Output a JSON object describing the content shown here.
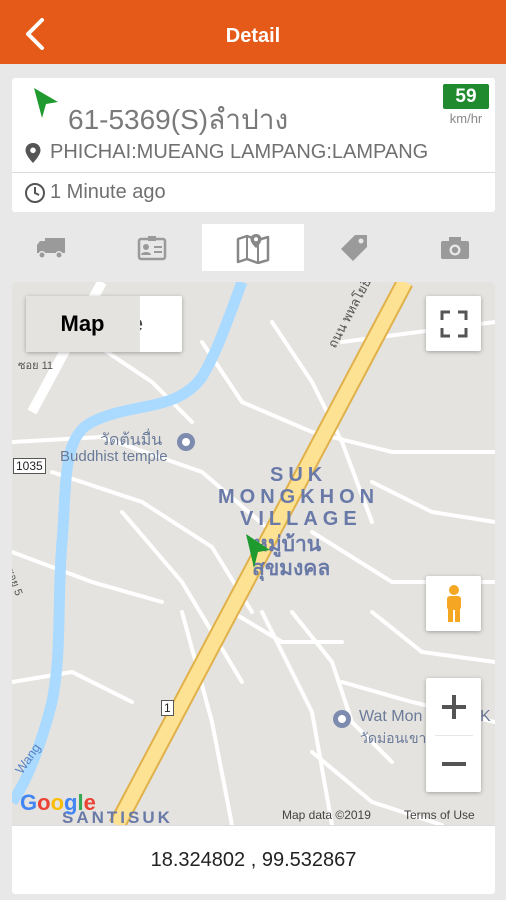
{
  "header": {
    "title": "Detail",
    "back_icon": "chevron-left-icon"
  },
  "vehicle": {
    "plate": "61-5369(S)ลำปาง",
    "speed": "59",
    "speed_unit": "km/hr",
    "location": "PHICHAI:MUEANG LAMPANG:LAMPANG",
    "last_update": "1 Minute ago",
    "status_color": "#1f8a2e"
  },
  "tabs": [
    {
      "icon": "truck-icon"
    },
    {
      "icon": "id-card-icon"
    },
    {
      "icon": "map-icon",
      "active": true
    },
    {
      "icon": "tag-icon"
    },
    {
      "icon": "camera-icon"
    }
  ],
  "map": {
    "type_options": [
      "Map",
      "Satellite"
    ],
    "selected_type": "Map",
    "area_name_en": [
      "SUK",
      "MONGKHON",
      "VILLAGE"
    ],
    "area_name_th": [
      "หมู่บ้าน",
      "สุขมงคล"
    ],
    "poi_1_th": "วัดต้นมื่น",
    "poi_1_en": "Buddhist temple",
    "poi_2_en": "Wat Mon",
    "poi_2_suffix": "K",
    "poi_2_th": "วัดม่อนเขา",
    "road_thai": "ถนน พหลโยธิน",
    "road_1035": "1035",
    "road_1": "1",
    "road_top_left": "ซอย 11",
    "river": "Wang",
    "area_bottom": "SANTISUK",
    "side_label": "ซอย 5",
    "logo": "Google",
    "map_data": "Map data ©2019",
    "terms": "Terms of Use"
  },
  "coordinates": "18.324802 , 99.532867"
}
